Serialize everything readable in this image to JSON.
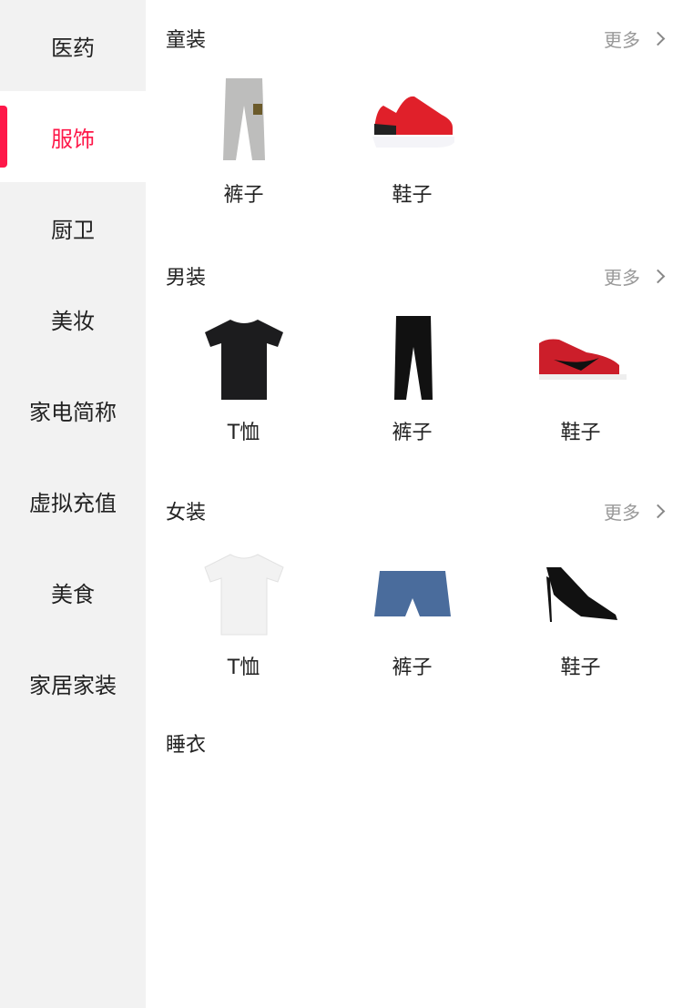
{
  "accent": "#fe1849",
  "sidebar": {
    "items": [
      {
        "label": "医药"
      },
      {
        "label": "服饰",
        "active": true
      },
      {
        "label": "厨卫"
      },
      {
        "label": "美妆"
      },
      {
        "label": "家电简称"
      },
      {
        "label": "虚拟充值"
      },
      {
        "label": "美食"
      },
      {
        "label": "家居家装"
      }
    ]
  },
  "sections": [
    {
      "title": "童装",
      "more": "更多",
      "products": [
        {
          "label": "裤子",
          "icon": "pants"
        },
        {
          "label": "鞋子",
          "icon": "sneaker"
        }
      ]
    },
    {
      "title": "男装",
      "more": "更多",
      "products": [
        {
          "label": "T恤",
          "icon": "tshirt-black"
        },
        {
          "label": "裤子",
          "icon": "pants-black"
        },
        {
          "label": "鞋子",
          "icon": "sneaker-red-high"
        }
      ]
    },
    {
      "title": "女装",
      "more": "更多",
      "products": [
        {
          "label": "T恤",
          "icon": "tshirt-white"
        },
        {
          "label": "裤子",
          "icon": "denim-shorts"
        },
        {
          "label": "鞋子",
          "icon": "high-heel"
        }
      ]
    },
    {
      "title": "睡衣",
      "products": []
    }
  ]
}
